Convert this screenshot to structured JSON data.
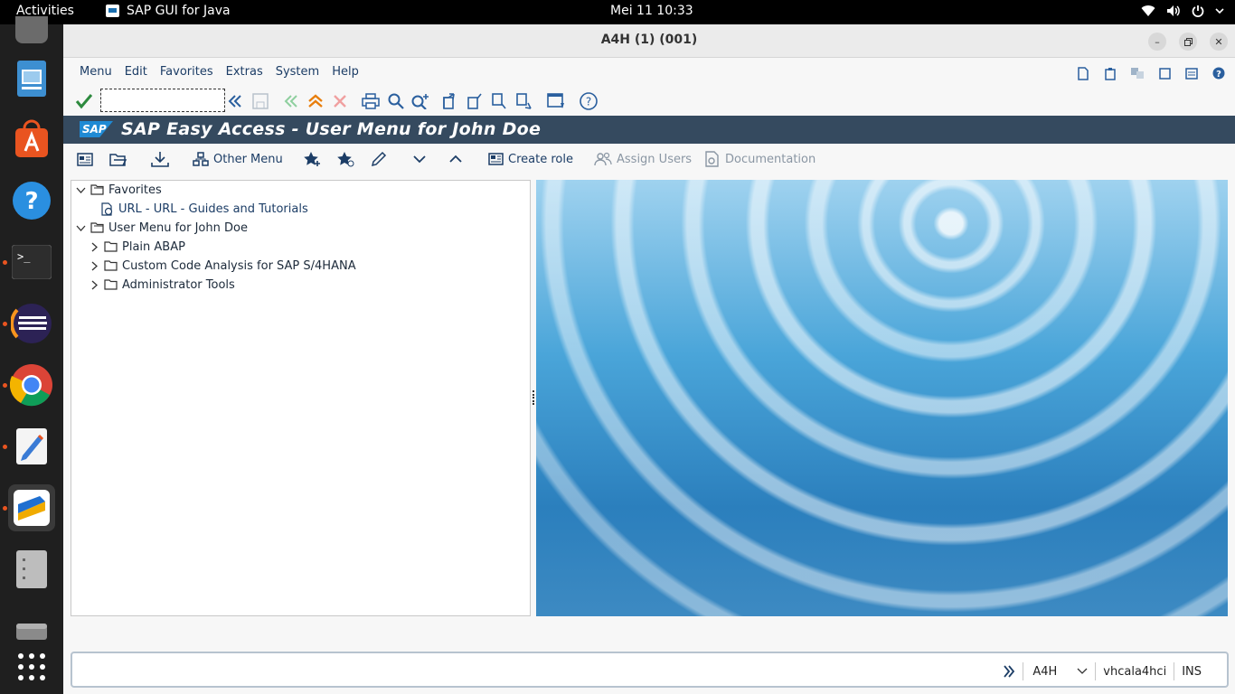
{
  "topbar": {
    "activities": "Activities",
    "app_name": "SAP GUI for Java",
    "clock": "Mei 11  10:33"
  },
  "window": {
    "title": "A4H (1) (001)"
  },
  "menubar": {
    "items": [
      "Menu",
      "Edit",
      "Favorites",
      "Extras",
      "System",
      "Help"
    ]
  },
  "toolbar": {
    "okcode_value": ""
  },
  "header": {
    "logo": "SAP",
    "title": "SAP Easy Access  -  User Menu for John Doe"
  },
  "app_toolbar": {
    "other_menu": "Other Menu",
    "create_role": "Create role",
    "assign_users": "Assign Users",
    "documentation": "Documentation"
  },
  "tree": {
    "favorites": "Favorites",
    "favorites_url": "URL - URL - Guides and Tutorials",
    "user_menu": "User Menu for John Doe",
    "folders": [
      "Plain ABAP",
      "Custom Code Analysis for SAP S/4HANA",
      "Administrator Tools"
    ]
  },
  "statusbar": {
    "system": "A4H",
    "server": "vhcala4hci",
    "mode": "INS"
  },
  "colors": {
    "header_bg": "#354a5f",
    "link_text": "#1c3d66",
    "accent_orange": "#e95420"
  },
  "icons": {
    "dock": [
      "files-icon",
      "app-center-icon",
      "help-icon",
      "terminal-icon",
      "eclipse-icon",
      "chrome-icon",
      "text-editor-icon",
      "sap-gui-icon",
      "archive-icon",
      "drive-icon",
      "app-grid-icon"
    ]
  }
}
